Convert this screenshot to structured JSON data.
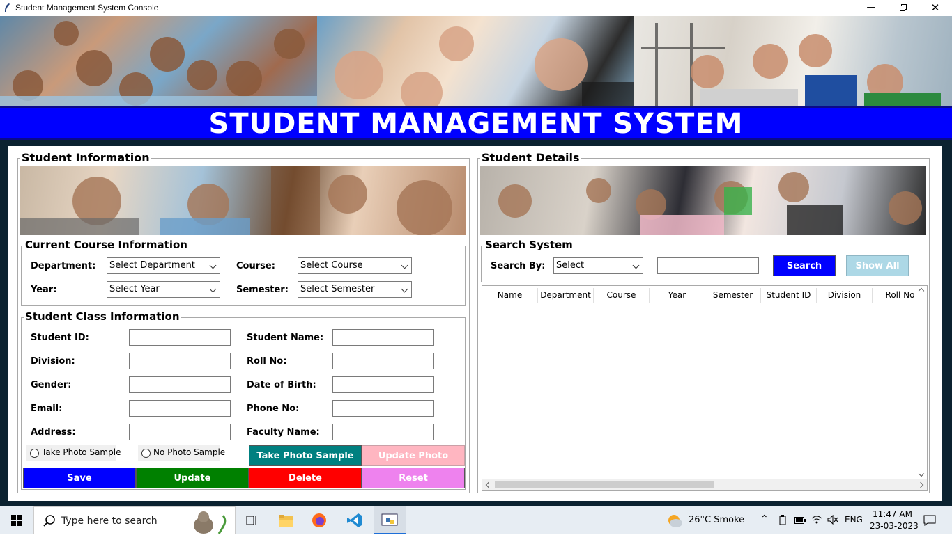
{
  "window": {
    "title": "Student Management System Console"
  },
  "header": {
    "title": "STUDENT MANAGEMENT SYSTEM"
  },
  "student_info": {
    "title": "Student Information",
    "course": {
      "title": "Current Course Information",
      "department_label": "Department:",
      "department_value": "Select Department",
      "course_label": "Course:",
      "course_value": "Select Course",
      "year_label": "Year:",
      "year_value": "Select Year",
      "semester_label": "Semester:",
      "semester_value": "Select Semester"
    },
    "class": {
      "title": "Student Class Information",
      "student_id": "Student ID:",
      "student_name": "Student Name:",
      "division": "Division:",
      "roll_no": "Roll No:",
      "gender": "Gender:",
      "dob": "Date of Birth:",
      "email": "Email:",
      "phone": "Phone No:",
      "address": "Address:",
      "faculty": "Faculty Name:",
      "radio_take": "Take Photo Sample",
      "radio_no": "No Photo Sample"
    },
    "buttons": {
      "take_photo": "Take Photo Sample",
      "update_photo": "Update Photo",
      "save": "Save",
      "update": "Update",
      "delete": "Delete",
      "reset": "Reset"
    }
  },
  "student_details": {
    "title": "Student Details",
    "search": {
      "title": "Search System",
      "by_label": "Search By:",
      "by_value": "Select",
      "search_btn": "Search",
      "showall_btn": "Show All"
    },
    "table": {
      "columns": [
        "Name",
        "Department",
        "Course",
        "Year",
        "Semester",
        "Student ID",
        "Division",
        "Roll No"
      ]
    }
  },
  "taskbar": {
    "search_placeholder": "Type here to search",
    "weather": "26°C  Smoke",
    "language": "ENG",
    "time": "11:47 AM",
    "date": "23-03-2023"
  },
  "colors": {
    "header_blue": "#0000ff",
    "save": "#0000ff",
    "update": "#008000",
    "delete": "#ff0000",
    "reset": "#ee82ee",
    "take_photo": "#008080",
    "update_photo": "#ffb6c1",
    "search": "#0000ff",
    "show_all": "#add8e6"
  }
}
